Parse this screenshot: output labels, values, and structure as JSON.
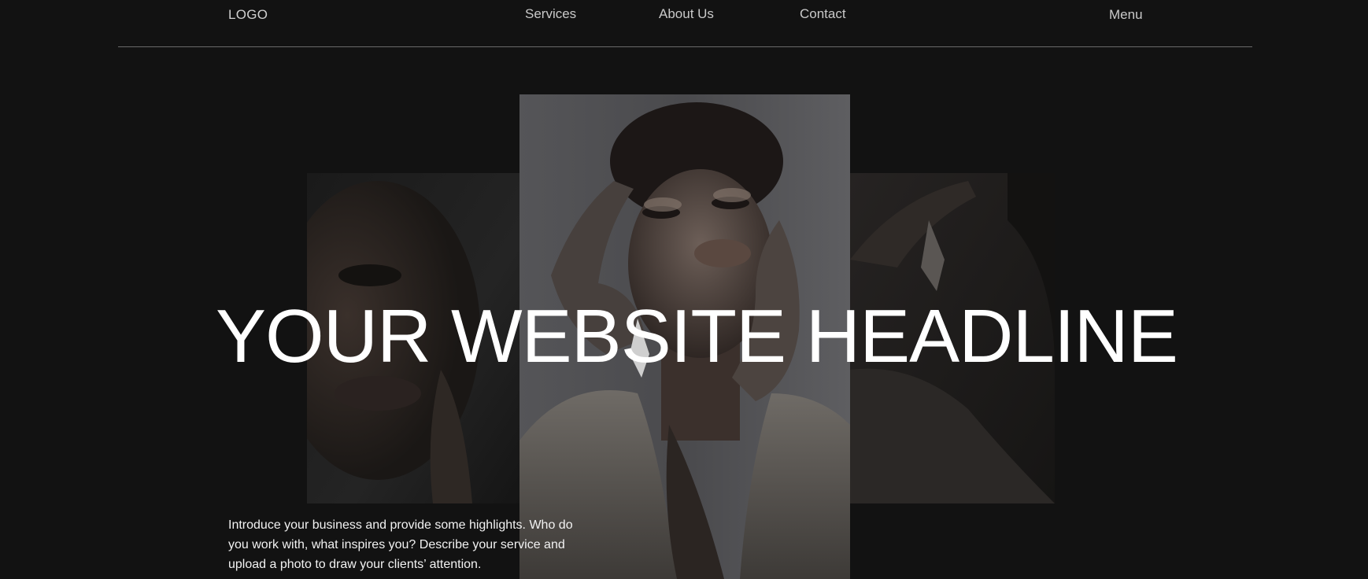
{
  "header": {
    "logo": "LOGO",
    "nav": [
      {
        "label": "Services"
      },
      {
        "label": "About Us"
      },
      {
        "label": "Contact"
      }
    ],
    "menu_label": "Menu"
  },
  "hero": {
    "headline": "YOUR WEBSITE  HEADLINE",
    "intro": "Introduce your business and provide some highlights. Who do you work with, what inspires you? Describe your service and upload a photo to draw your clients’ attention."
  },
  "colors": {
    "background": "#121212",
    "text": "#ffffff",
    "nav_text": "#c9c9c9",
    "divider": "#6a6a6a"
  }
}
